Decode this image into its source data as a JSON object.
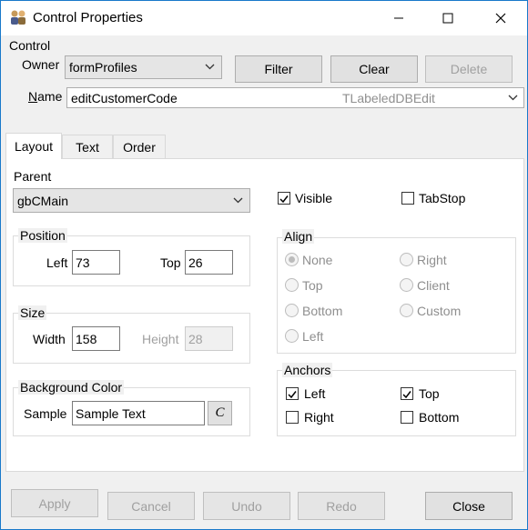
{
  "window": {
    "title": "Control Properties",
    "buttons": {
      "minimize": "—",
      "maximize": "☐",
      "close": "✕"
    }
  },
  "control": {
    "group_label": "Control",
    "owner_label": "Owner",
    "owner_value": "formProfiles",
    "filter_label": "Filter",
    "clear_label": "Clear",
    "delete_label": "Delete",
    "name_label": "Name",
    "name_value": "editCustomerCode",
    "name_type": "TLabeledDBEdit"
  },
  "tabs": [
    {
      "label": "Layout",
      "active": true
    },
    {
      "label": "Text",
      "active": false
    },
    {
      "label": "Order",
      "active": false
    }
  ],
  "layout": {
    "parent_label": "Parent",
    "parent_value": "gbCMain",
    "visible_label": "Visible",
    "visible_checked": true,
    "tabstop_label": "TabStop",
    "tabstop_checked": false,
    "position": {
      "group_label": "Position",
      "left_label": "Left",
      "left_value": "73",
      "top_label": "Top",
      "top_value": "26"
    },
    "size": {
      "group_label": "Size",
      "width_label": "Width",
      "width_value": "158",
      "height_label": "Height",
      "height_value": "28"
    },
    "background": {
      "group_label": "Background Color",
      "sample_label": "Sample",
      "sample_value": "Sample Text",
      "color_button_label": "C"
    },
    "align": {
      "group_label": "Align",
      "options": [
        "None",
        "Right",
        "Top",
        "Client",
        "Bottom",
        "Custom",
        "Left"
      ],
      "selected": "None"
    },
    "anchors": {
      "group_label": "Anchors",
      "left_label": "Left",
      "left_checked": true,
      "top_label": "Top",
      "top_checked": true,
      "right_label": "Right",
      "right_checked": false,
      "bottom_label": "Bottom",
      "bottom_checked": false
    }
  },
  "footer": {
    "apply_label": "Apply",
    "cancel_label": "Cancel",
    "undo_label": "Undo",
    "redo_label": "Redo",
    "close_label": "Close"
  },
  "colors": {
    "accent": "#0078d7",
    "window_border": "#1979ca",
    "disabled_text": "#a0a0a0"
  }
}
